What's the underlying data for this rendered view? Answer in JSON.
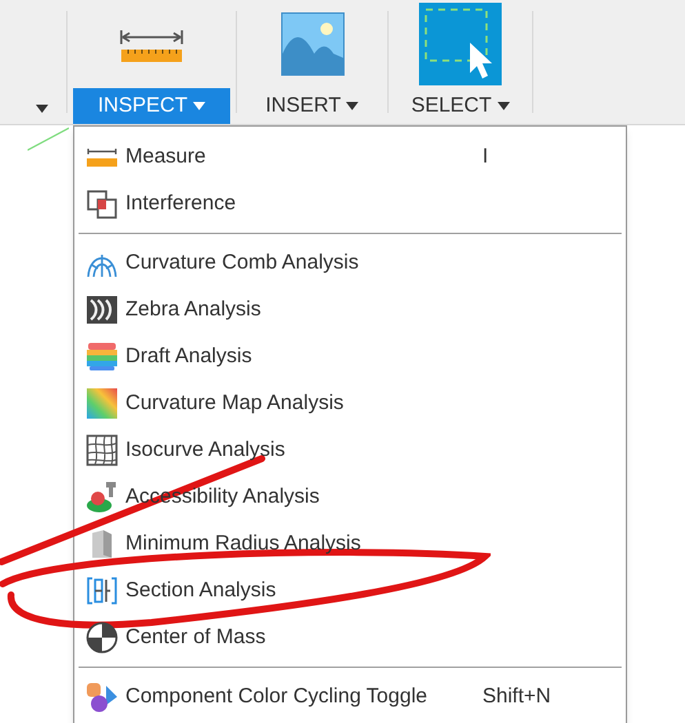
{
  "toolbar": {
    "groups": [
      {
        "label": "INSPECT",
        "selected": true
      },
      {
        "label": "INSERT",
        "selected": false
      },
      {
        "label": "SELECT",
        "selected": false
      }
    ]
  },
  "menu": {
    "sections": [
      {
        "items": [
          {
            "label": "Measure",
            "shortcut": "I"
          },
          {
            "label": "Interference"
          }
        ]
      },
      {
        "items": [
          {
            "label": "Curvature Comb Analysis"
          },
          {
            "label": "Zebra Analysis"
          },
          {
            "label": "Draft Analysis"
          },
          {
            "label": "Curvature Map Analysis"
          },
          {
            "label": "Isocurve Analysis"
          },
          {
            "label": "Accessibility Analysis"
          },
          {
            "label": "Minimum Radius Analysis"
          },
          {
            "label": "Section Analysis"
          },
          {
            "label": "Center of Mass"
          }
        ]
      },
      {
        "items": [
          {
            "label": "Component Color Cycling Toggle",
            "shortcut": "Shift+N"
          }
        ]
      }
    ]
  }
}
